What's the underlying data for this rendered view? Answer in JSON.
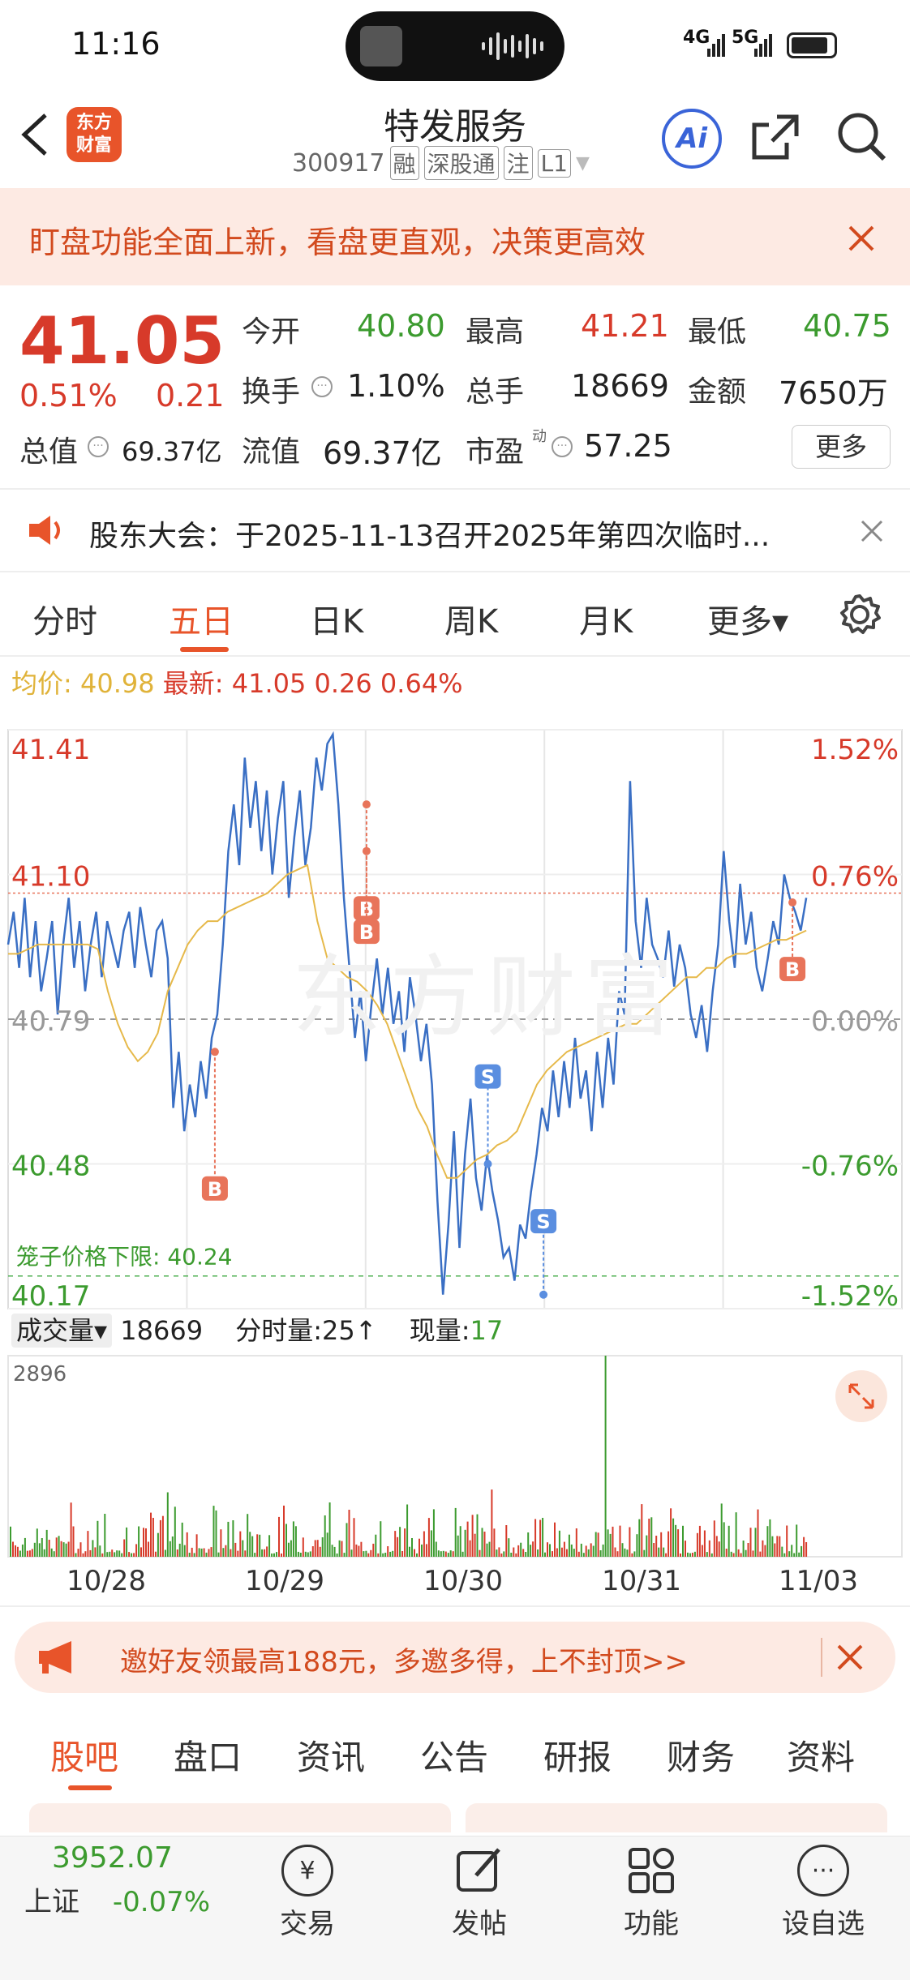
{
  "status": {
    "time": "11:16",
    "net1": "4G",
    "net2": "5G"
  },
  "nav": {
    "title": "特发服务",
    "code": "300917",
    "tags": [
      "融",
      "深股通",
      "注",
      "L1"
    ],
    "logo": "东方\n财富",
    "ai": "Ai"
  },
  "banner": {
    "text": "盯盘功能全面上新，看盘更直观，决策更高效"
  },
  "quote": {
    "price": "41.05",
    "pct": "0.51%",
    "chg": "0.21",
    "open_label": "今开",
    "open": "40.80",
    "high_label": "最高",
    "high": "41.21",
    "low_label": "最低",
    "low": "40.75",
    "turnover_label": "换手",
    "turnover": "1.10%",
    "volume_label": "总手",
    "volume": "18669",
    "amount_label": "金额",
    "amount": "7650万",
    "mcap_label": "总值",
    "mcap": "69.37亿",
    "float_label": "流值",
    "float": "69.37亿",
    "pe_label": "市盈",
    "pe_sup": "动",
    "pe": "57.25",
    "more": "更多"
  },
  "notice": {
    "text": "股东大会：于2025-11-13召开2025年第四次临时..."
  },
  "tabs": [
    "分时",
    "五日",
    "日K",
    "周K",
    "月K",
    "更多▾"
  ],
  "avg": {
    "avg_label": "均价:",
    "avg": "40.98",
    "last_label": "最新:",
    "last": "41.05",
    "chg": "0.26",
    "pct": "0.64%"
  },
  "chart_data": {
    "type": "line",
    "title": "",
    "x": [
      "10/28",
      "10/29",
      "10/30",
      "10/31",
      "11/03"
    ],
    "y_left_ticks": [
      "41.41",
      "41.10",
      "40.79",
      "40.48",
      "40.17"
    ],
    "y_right_ticks": [
      "1.52%",
      "0.76%",
      "0.00%",
      "-0.76%",
      "-1.52%"
    ],
    "ylim": [
      40.17,
      41.41
    ],
    "prev_close": 40.79,
    "cage_label": "笼子价格下限:",
    "cage_value": "40.24",
    "series": [
      {
        "values": [
          40.95,
          41.02,
          40.9,
          41.05,
          40.88,
          41.0,
          40.85,
          40.92,
          41.0,
          40.8,
          40.95,
          41.05,
          40.9,
          41.0,
          40.85,
          40.95,
          41.02,
          40.88,
          41.0,
          40.95,
          40.9,
          40.98,
          41.02,
          40.9,
          41.03,
          40.95,
          40.88,
          40.98,
          41.0,
          40.92,
          40.6,
          40.72,
          40.55,
          40.65,
          40.58,
          40.7,
          40.62,
          40.75,
          40.8,
          40.95,
          41.15,
          41.25,
          41.12,
          41.35,
          41.2,
          41.3,
          41.15,
          41.28,
          41.1,
          41.22,
          41.3,
          41.05,
          41.18,
          41.28,
          41.12,
          41.2,
          41.35,
          41.28,
          41.38,
          41.4,
          41.25,
          41.05,
          40.9,
          40.75,
          40.85,
          40.7,
          40.82,
          40.92,
          40.8,
          40.9,
          40.78,
          40.85,
          40.72,
          40.88,
          40.8,
          40.7,
          40.78,
          40.65,
          40.4,
          40.2,
          40.35,
          40.55,
          40.3,
          40.5,
          40.62,
          40.45,
          40.38,
          40.5,
          40.42,
          40.36,
          40.28,
          40.3,
          40.23,
          40.35,
          40.32,
          40.42,
          40.5,
          40.6,
          40.55,
          40.68,
          40.58,
          40.7,
          40.6,
          40.75,
          40.62,
          40.68,
          40.55,
          40.72,
          40.6,
          40.75,
          40.65,
          40.85,
          40.8,
          41.3,
          41.0,
          40.9,
          41.05,
          40.95,
          40.92,
          40.88,
          40.98,
          40.86,
          40.95,
          40.9,
          40.8,
          40.75,
          40.82,
          40.72,
          40.85,
          40.95,
          41.15,
          41.0,
          40.9,
          41.08,
          40.95,
          41.02,
          40.9,
          40.85,
          40.92,
          41.0,
          40.95,
          41.1,
          41.05,
          41.02,
          40.98,
          41.05
        ]
      },
      {
        "name": "均价",
        "values": [
          40.93,
          40.93,
          40.94,
          40.95,
          40.95,
          40.95,
          40.95,
          40.95,
          40.95,
          40.94,
          40.85,
          40.78,
          40.73,
          40.7,
          40.72,
          40.76,
          40.85,
          40.9,
          40.95,
          40.98,
          41.0,
          41.0,
          41.02,
          41.03,
          41.04,
          41.05,
          41.06,
          41.08,
          41.1,
          41.11,
          41.12,
          41.0,
          40.92,
          40.9,
          40.88,
          40.87,
          40.85,
          40.82,
          40.78,
          40.72,
          40.66,
          40.6,
          40.56,
          40.5,
          40.45,
          40.45,
          40.47,
          40.49,
          40.5,
          40.52,
          40.53,
          40.55,
          40.6,
          40.65,
          40.68,
          40.7,
          40.72,
          40.73,
          40.74,
          40.75,
          40.76,
          40.77,
          40.78,
          40.78,
          40.8,
          40.82,
          40.84,
          40.86,
          40.88,
          40.88,
          40.9,
          40.9,
          40.92,
          40.93,
          40.93,
          40.94,
          40.95,
          40.96,
          40.96,
          40.97,
          40.98
        ]
      }
    ],
    "markers": [
      "B",
      "B",
      "B",
      "S",
      "S",
      "B"
    ]
  },
  "volume": {
    "label": "成交量▾",
    "total": "18669",
    "tick_label": "分时量:",
    "tick": "25",
    "tick_arrow": "↑",
    "cur_label": "现量:",
    "cur": "17",
    "max": "2896"
  },
  "invite": {
    "text": "邀好友领最高188元，多邀多得，上不封顶>>"
  },
  "subtabs": [
    "股吧",
    "盘口",
    "资讯",
    "公告",
    "研报",
    "财务",
    "资料"
  ],
  "bottom": {
    "index_value": "3952.07",
    "index_name": "上证",
    "index_pct": "-0.07%",
    "items": [
      "交易",
      "发帖",
      "功能",
      "设自选"
    ]
  }
}
